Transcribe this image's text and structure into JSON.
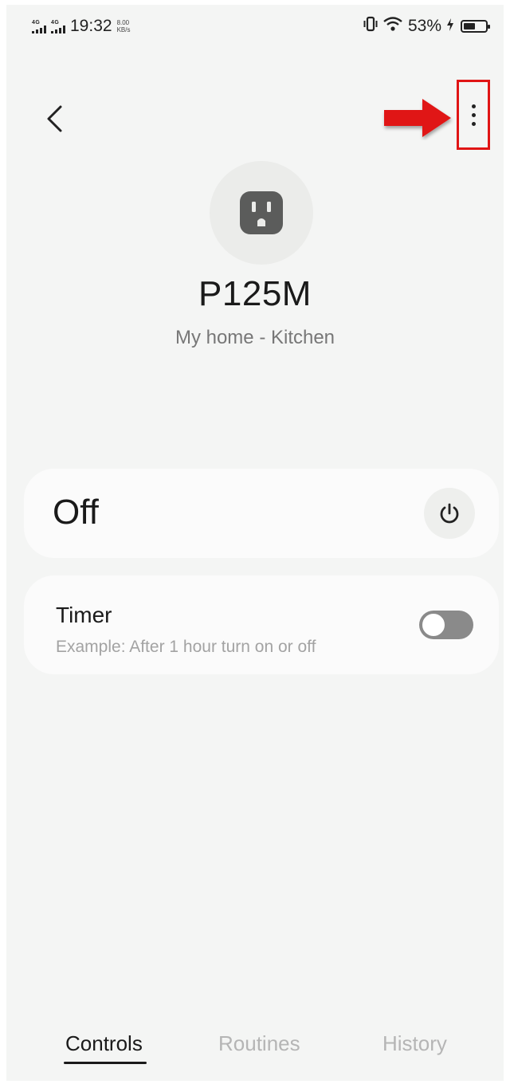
{
  "status_bar": {
    "sim1_label": "4G",
    "sim2_label": "4G",
    "time": "19:32",
    "net_speed_value": "8.00",
    "net_speed_unit": "KB/s",
    "battery_percent": "53%",
    "battery_level": 0.53,
    "icons": [
      "vibrate-icon",
      "wifi-icon",
      "charging-icon",
      "battery-icon"
    ]
  },
  "header": {
    "back_icon": "chevron-left-icon",
    "more_icon": "more-vertical-icon",
    "annotation": {
      "arrow_color": "#e01515",
      "highlight_color": "#e01515"
    }
  },
  "device": {
    "icon": "outlet-icon",
    "name": "P125M",
    "location": "My home - Kitchen"
  },
  "power": {
    "state_label": "Off",
    "icon": "power-icon"
  },
  "timer": {
    "title": "Timer",
    "description": "Example: After 1 hour turn on or off",
    "enabled": false
  },
  "tabs": [
    {
      "label": "Controls",
      "active": true
    },
    {
      "label": "Routines",
      "active": false
    },
    {
      "label": "History",
      "active": false
    }
  ]
}
